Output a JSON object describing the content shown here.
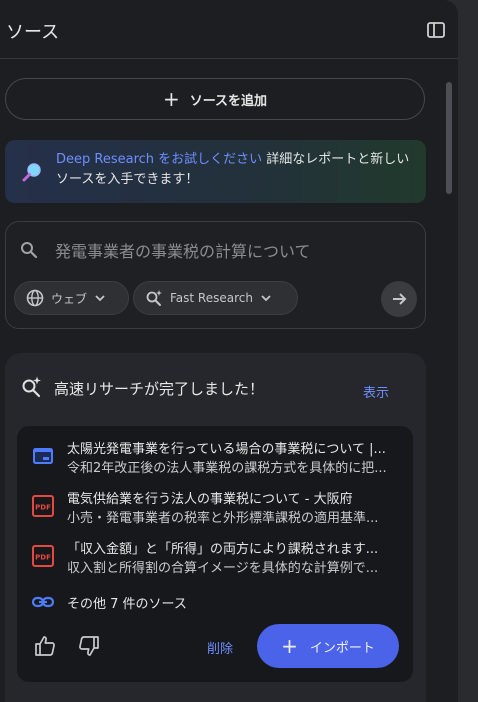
{
  "header": {
    "title": "ソース",
    "panel_toggle_icon": "panel-toggle-icon"
  },
  "add_source": {
    "label": "ソースを追加",
    "icon": "plus-icon"
  },
  "deep_research_banner": {
    "link_text": "Deep Research をお試しください",
    "body_text": " 詳細なレポートと新しいソースを入手できます！",
    "icon": "magnifier-sparkle-icon"
  },
  "query": {
    "text": "発電事業者の事業税の計算について",
    "source_chip": {
      "label": "ウェブ",
      "icon": "globe-icon"
    },
    "mode_chip": {
      "label": "Fast Research",
      "icon": "sparkle-search-icon"
    },
    "send_icon": "arrow-right-icon"
  },
  "result": {
    "title": "高速リサーチが完了しました！",
    "show_label": "表示",
    "sources": [
      {
        "type": "web",
        "title": "太陽光発電事業を行っている場合の事業税について |...",
        "snippet": "令和2年改正後の法人事業税の課税方式を具体的に把..."
      },
      {
        "type": "pdf",
        "title": "電気供給業を行う法人の事業税について - 大阪府",
        "snippet": "小売・発電事業者の税率と外形標準課税の適用基準..."
      },
      {
        "type": "pdf",
        "title": "「収入金額」と「所得」の両方により課税されます...",
        "snippet": "収入割と所得割の合算イメージを具体的な計算例で..."
      }
    ],
    "more_label": "その他 7 件のソース",
    "delete_label": "削除",
    "import_label": "インポート"
  },
  "colors": {
    "accent": "#6e8eff",
    "import_button": "#4a63e8",
    "pdf_red": "#e5483f",
    "web_blue": "#4d7cff"
  }
}
